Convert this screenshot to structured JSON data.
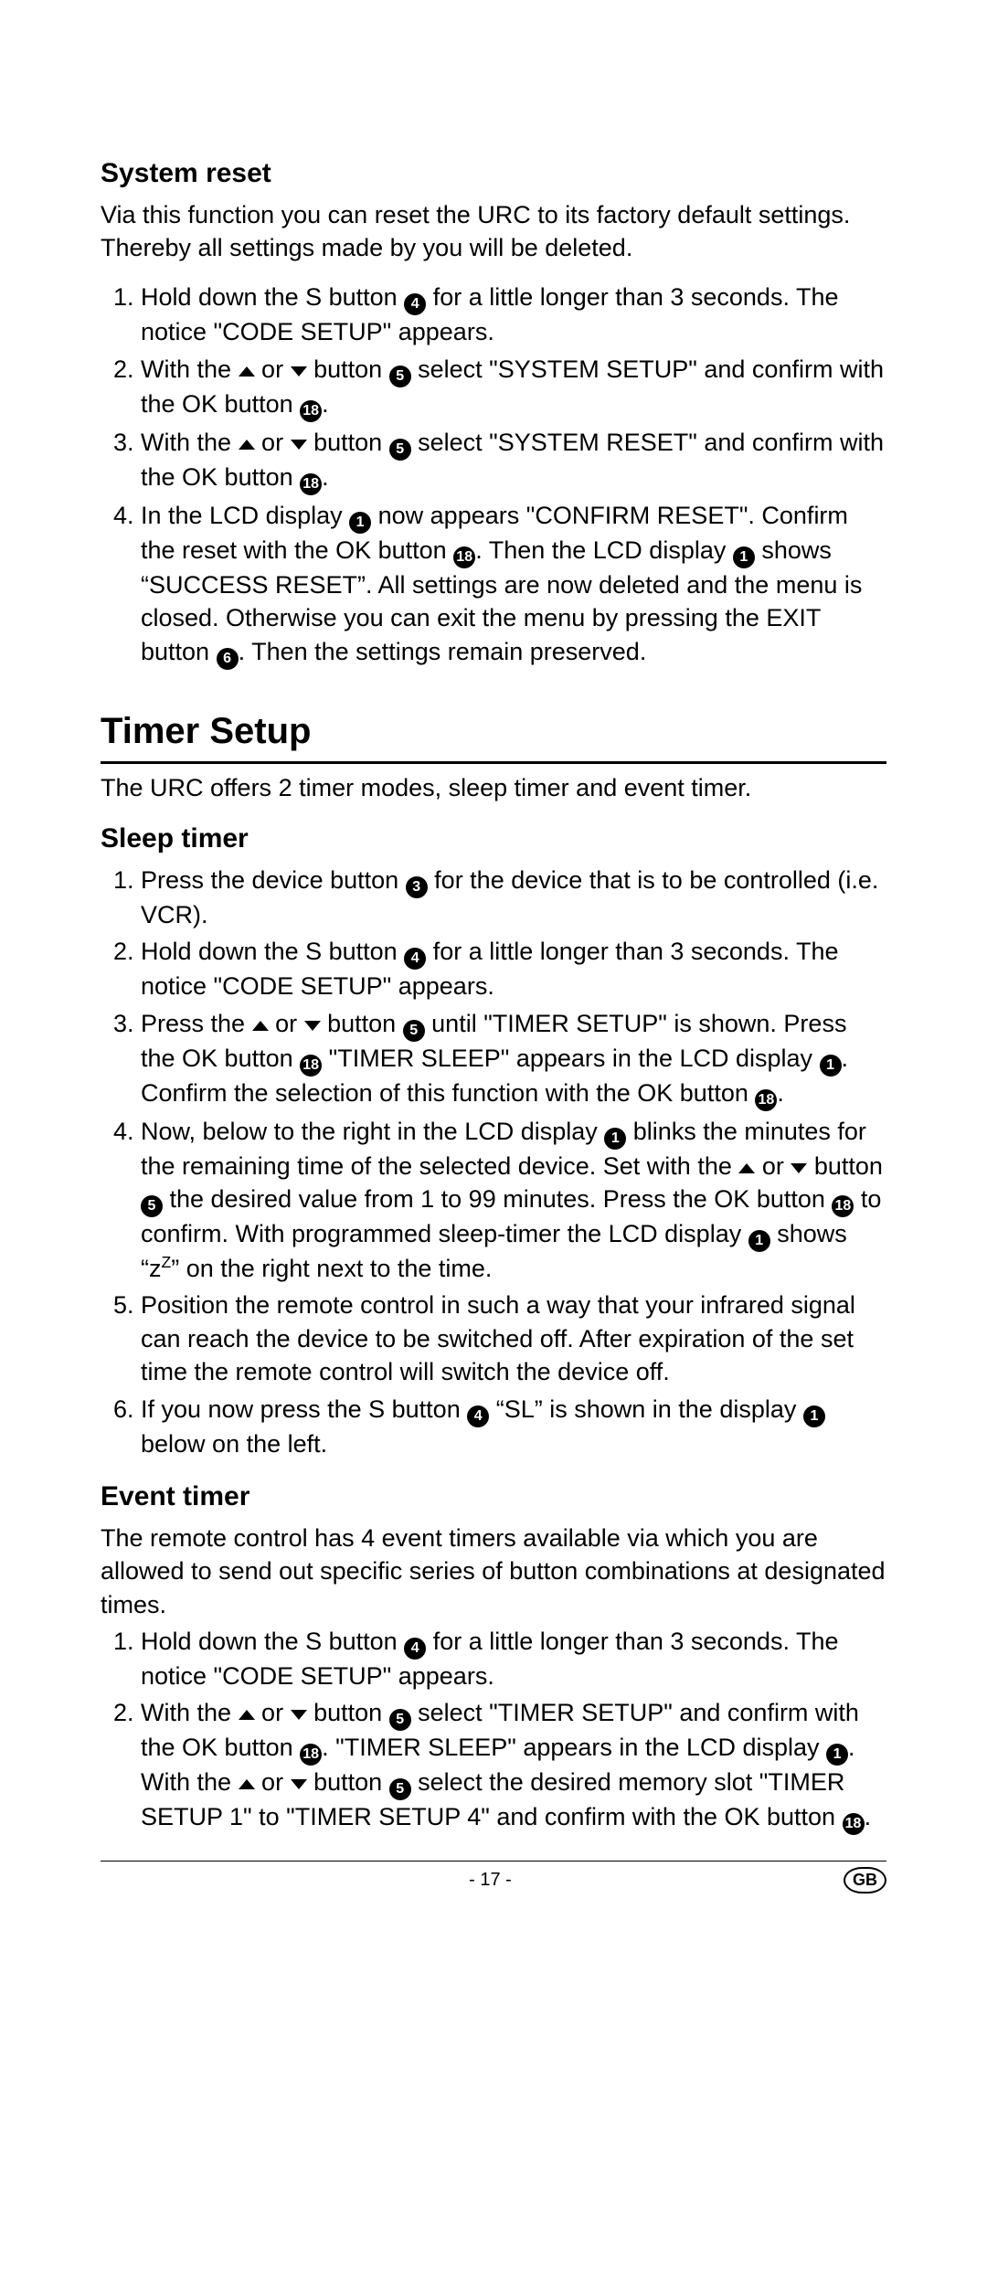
{
  "icons": {
    "n1": "1",
    "n3": "3",
    "n4": "4",
    "n5": "5",
    "n6": "6",
    "n18": "18"
  },
  "system_reset": {
    "heading": "System reset",
    "intro": "Via this function you can reset the URC to its factory default settings. Thereby all settings made by you will be deleted.",
    "s1a": "Hold down the S button ",
    "s1b": " for a little longer than 3 sec­onds. The notice \"CODE SETUP\" appears.",
    "s2a": "With the ",
    "s2b": " or ",
    "s2c": " button ",
    "s2d": " select \"SYSTEM SETUP\" and confirm with the OK button ",
    "s2e": ".",
    "s3a": "With the ",
    "s3b": " or ",
    "s3c": " button ",
    "s3d": " select \"SYSTEM RESET\" and confirm with the OK button ",
    "s3e": ".",
    "s4a": "In the LCD display ",
    "s4b": " now appears \"CONFIRM RESET\". Confirm the reset with the OK button ",
    "s4c": ". Then the LCD display ",
    "s4d": " shows “SUCCESS RESET”. All settings are now deleted and the menu is closed. Otherwise you can exit the menu by pressing the EXIT button ",
    "s4e": ". Then the set­tings remain preserved."
  },
  "timer_setup": {
    "heading": "Timer Setup",
    "intro": "The URC offers 2 timer modes, sleep timer and event timer."
  },
  "sleep_timer": {
    "heading": "Sleep timer",
    "s1a": "Press the device button ",
    "s1b": " for the device that is to be con­trolled (i.e. VCR).",
    "s2a": "Hold down the S button ",
    "s2b": " for a little longer than 3 sec­onds. The notice \"CODE SETUP\" appears.",
    "s3a": "Press the ",
    "s3b": " or ",
    "s3c": " button ",
    "s3d": " until \"TIMER SETUP\" is shown. Press the OK button ",
    "s3e": " \"TIMER SLEEP\" appears in the LCD display ",
    "s3f": ".  Confirm the selection of this function with the OK button ",
    "s3g": ".",
    "s4a": "Now, below to the right in the LCD display ",
    "s4b": " blinks the minutes for the remaining time of the selected device. Set with the ",
    "s4c": " or ",
    "s4d": " button ",
    "s4e": " the desired value from 1 to 99 minutes. Press the OK button ",
    "s4f": " to confirm. With programmed sleep-timer the LCD display ",
    "s4g1": " shows “",
    "s4g2": "” on the right next to the time.",
    "s4zz": "zZ",
    "s5": "Position the remote control in such a way that your infra­red signal can reach the device to be switched off. After expiration of the set time the remote control will switch the device off.",
    "s6a": "If you now press the S button ",
    "s6b": " “SL” is shown in the dis­play ",
    "s6c": " below on the left."
  },
  "event_timer": {
    "heading": "Event timer",
    "intro": "The remote control has 4 event timers available via which you are allowed to send out specific series of button combi­nations at designated times.",
    "s1a": "Hold down the S button ",
    "s1b": " for a little longer than 3 sec­onds. The notice \"CODE SETUP\" appears.",
    "s2a": "With the ",
    "s2b": " or ",
    "s2c": " button ",
    "s2d": " select \"TIMER SETUP\" and confirm with the OK button ",
    "s2e": ". \"TIMER SLEEP\" appears in the LCD display ",
    "s2f": ".  With the ",
    "s2g": " or ",
    "s2h": " button ",
    "s2i": " select the desired memory slot \"TIMER SETUP 1\" to \"TIMER SETUP 4\" and confirm with the OK button ",
    "s2j": "."
  },
  "footer": {
    "page": "- 17 -",
    "country": "GB"
  }
}
